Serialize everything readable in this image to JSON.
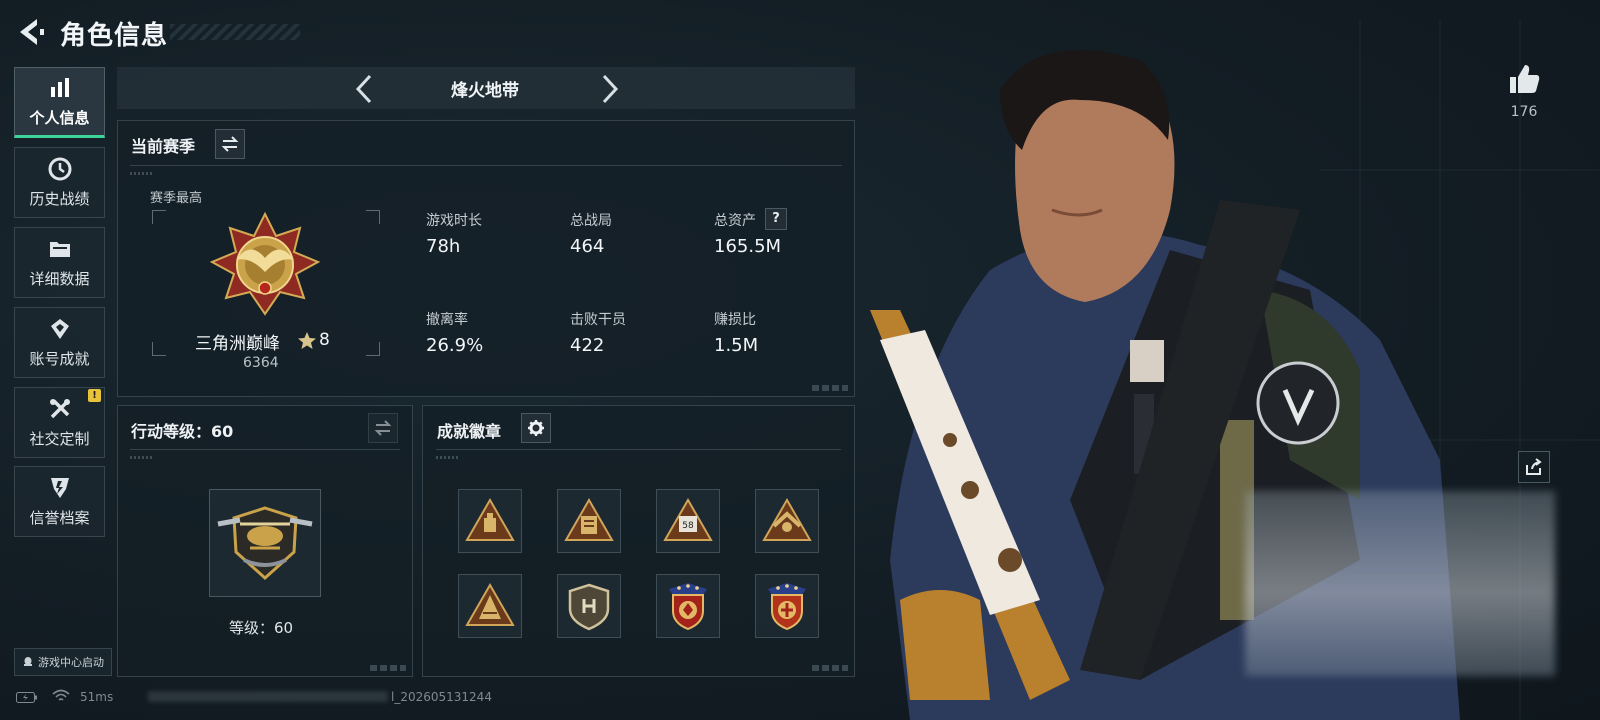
{
  "header": {
    "title": "角色信息",
    "back_icon": "back-arrow-icon"
  },
  "sidebar": {
    "items": [
      {
        "label": "个人信息",
        "icon": "bar-chart-icon",
        "active": true
      },
      {
        "label": "历史战绩",
        "icon": "history-clock-icon",
        "active": false
      },
      {
        "label": "详细数据",
        "icon": "folder-icon",
        "active": false
      },
      {
        "label": "账号成就",
        "icon": "achievement-icon",
        "active": false
      },
      {
        "label": "社交定制",
        "icon": "tools-icon",
        "active": false,
        "badge": "!"
      },
      {
        "label": "信誉档案",
        "icon": "credit-shield-icon",
        "active": false
      }
    ],
    "game_center_label": "游戏中心启动"
  },
  "mode_selector": {
    "current": "烽火地带"
  },
  "season": {
    "title": "当前赛季",
    "best_label": "赛季最高",
    "rank_name": "三角洲巅峰",
    "rank_stars": "8",
    "rank_points": "6364",
    "stats": [
      {
        "label": "游戏时长",
        "value": "78h"
      },
      {
        "label": "总战局",
        "value": "464"
      },
      {
        "label": "总资产",
        "value": "165.5M",
        "help": "?"
      },
      {
        "label": "撤离率",
        "value": "26.9%"
      },
      {
        "label": "击败干员",
        "value": "422"
      },
      {
        "label": "赚损比",
        "value": "1.5M"
      }
    ]
  },
  "operation_level": {
    "title": "行动等级：60",
    "caption": "等级：60"
  },
  "badges": {
    "title": "成就徽章",
    "items": [
      {
        "icon": "triangle-badge-icon"
      },
      {
        "icon": "triangle-badge-icon"
      },
      {
        "icon": "triangle-badge-icon",
        "number": "58"
      },
      {
        "icon": "triangle-badge-icon"
      },
      {
        "icon": "triangle-badge-icon"
      },
      {
        "icon": "shield-badge-icon"
      },
      {
        "icon": "star-shield-badge-icon"
      },
      {
        "icon": "star-shield-badge-icon"
      }
    ]
  },
  "social": {
    "like_count": "176"
  },
  "status": {
    "ping": "51ms",
    "build": "l_202605131244"
  },
  "colors": {
    "accent": "#3ed39b",
    "gold": "#c9a24a",
    "warning": "#e8c23a"
  }
}
